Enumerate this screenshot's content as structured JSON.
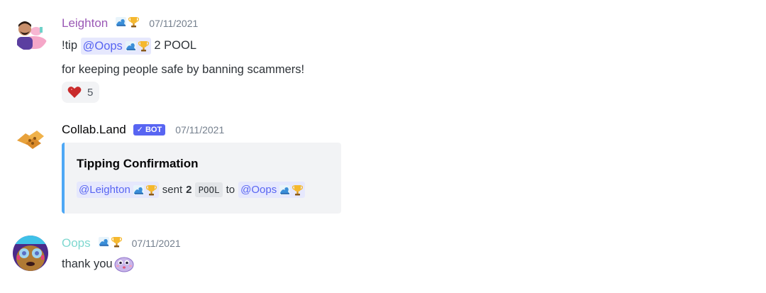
{
  "messages": [
    {
      "username": "Leighton",
      "timestamp": "07/11/2021",
      "lines": [
        {
          "prefix": "!tip",
          "mention": "@Oops",
          "suffix": "2 POOL"
        },
        {
          "text": "for keeping people safe by banning scammers!"
        }
      ],
      "reaction": {
        "emoji": "heart-icon",
        "count": "5"
      }
    },
    {
      "username": "Collab.Land",
      "bot_tag": "BOT",
      "timestamp": "07/11/2021",
      "embed": {
        "title": "Tipping Confirmation",
        "mention_from": "@Leighton",
        "sent_text": "sent",
        "amount": "2",
        "token": "POOL",
        "to_text": "to",
        "mention_to": "@Oops"
      }
    },
    {
      "username": "Oops",
      "timestamp": "07/11/2021",
      "text": "thank you"
    }
  ],
  "colors": {
    "leighton_name": "#9b59b6",
    "oops_name": "#7fd8d0",
    "mention_bg": "#e6e8fd",
    "mention_text": "#5865f2",
    "embed_border": "#4ea8f5",
    "bot_tag": "#5865f2"
  }
}
